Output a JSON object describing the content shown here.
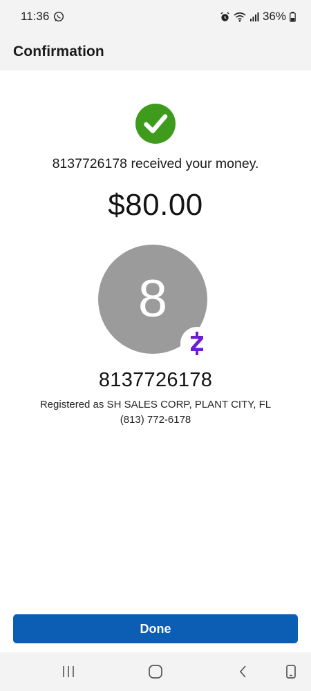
{
  "status_bar": {
    "time": "11:36",
    "battery": "36%",
    "icons": [
      "whatsapp-icon",
      "alarm-icon",
      "wifi-icon",
      "signal-icon",
      "battery-icon"
    ]
  },
  "header": {
    "title": "Confirmation"
  },
  "confirmation": {
    "message": "8137726178 received your money.",
    "amount": "$80.00",
    "avatar_initial": "8",
    "recipient": "8137726178",
    "registered": "Registered as SH SALES CORP, PLANT CITY, FL",
    "phone": "(813) 772-6178"
  },
  "actions": {
    "done_label": "Done"
  },
  "colors": {
    "success_green": "#3e9b1c",
    "primary_blue": "#0c5eb5",
    "zelle_purple": "#6d1ed4",
    "avatar_gray": "#9b9b9b"
  },
  "nav_bar": {
    "icons": [
      "recent-apps-icon",
      "home-icon",
      "back-icon",
      "rotate-icon"
    ]
  }
}
